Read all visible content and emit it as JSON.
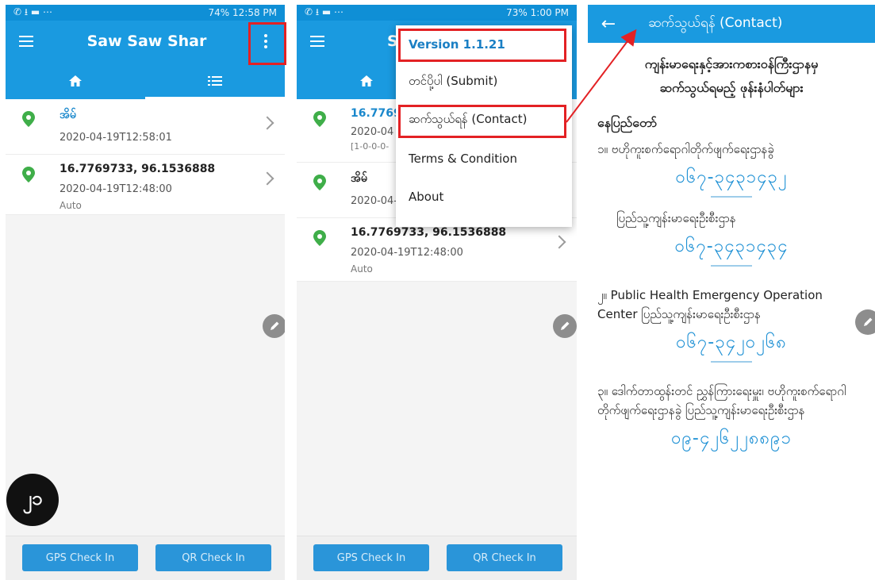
{
  "screens": [
    {
      "status": {
        "left_icons": "✆ ⭳ ▬ ⋯",
        "right": "74% 12:58 PM"
      },
      "title": "Saw Saw Shar",
      "items": [
        {
          "title": "အိမ်",
          "date": "2020-04-19T12:58:01",
          "sub": ""
        },
        {
          "title": "16.7769733, 96.1536888",
          "date": "2020-04-19T12:48:00",
          "sub": "Auto"
        }
      ],
      "buttons": {
        "gps": "GPS Check In",
        "qr": "QR Check In"
      }
    },
    {
      "status": {
        "left_icons": "✆ ⭳ ▬ ⋯",
        "right": "73% 1:00 PM"
      },
      "title_partial": "S",
      "items": [
        {
          "title": "16.7769",
          "date": "2020-04",
          "sub": "[1-0-0-0-"
        },
        {
          "title": "အိမ်",
          "date": "2020-04-19T12:58:01",
          "sub": ""
        },
        {
          "title": "16.7769733, 96.1536888",
          "date": "2020-04-19T12:48:00",
          "sub": "Auto"
        }
      ],
      "menu": [
        "Version 1.1.21",
        "တင်ပို့ပါ (Submit)",
        "ဆက်သွယ်ရန် (Contact)",
        "Terms & Condition",
        "About"
      ],
      "buttons": {
        "gps": "GPS Check In",
        "qr": "QR Check In"
      }
    },
    {
      "title": "ဆက်သွယ်ရန် (Contact)",
      "heading_line1": "ကျန်းမာရေးနှင့်အားကစားဝန်ကြီးဌာနမှ",
      "heading_line2": "ဆက်သွယ်ရမည့် ဖုန်းနံပါတ်များ",
      "region": "နေပြည်တော်",
      "entries": [
        {
          "text": "၁။ ဗဟိုကူးစက်ရောဂါတိုက်ဖျက်ရေးဌာနခွဲ",
          "phone": "၀၆၇-၃၄၃၁၄၃၂"
        },
        {
          "text": "ပြည်သူ့ကျန်းမာရေးဦးစီးဌာန",
          "phone": "၀၆၇-၃၄၃၁၄၃၄"
        },
        {
          "text": "၂။ Public Health Emergency Operation Center ပြည်သူ့ကျန်းမာရေးဦးစီးဌာန",
          "phone": "၀၆၇-၃၄၂၀၂၆၈"
        },
        {
          "text": "၃။ ဒေါက်တာထွန်းတင် ညွှန်ကြားရေးမှူး၊ ဗဟိုကူးစက်ရောဂါတိုက်ဖျက်ရေးဌာနခွဲ ပြည်သူ့ကျန်းမာရေးဦးစီးဌာန",
          "phone": "၀၉-၄၂၆၂၂၈၈၉၁"
        }
      ]
    }
  ],
  "badge": "၂၁",
  "colors": {
    "primary": "#1a9ae0",
    "highlight": "#e32124",
    "pin": "#3fae49"
  }
}
